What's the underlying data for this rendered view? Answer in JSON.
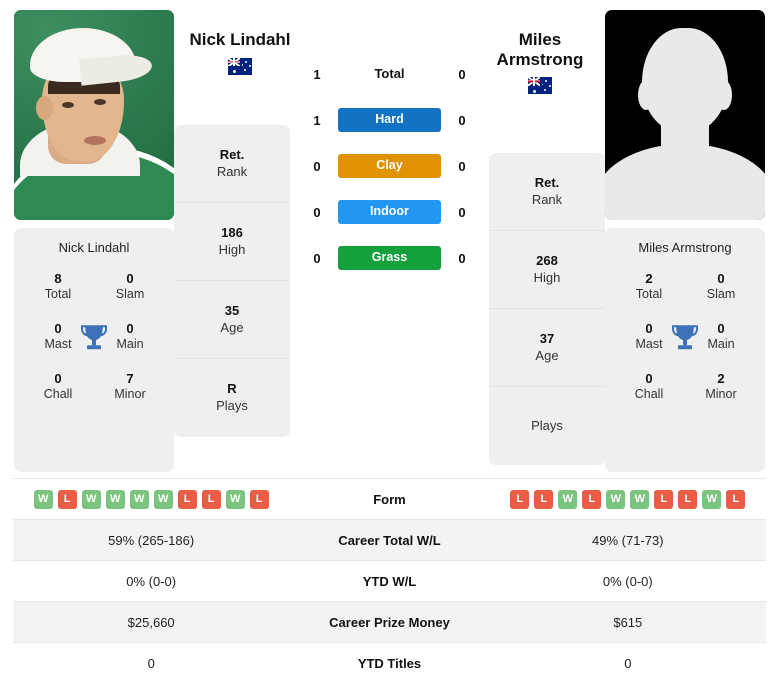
{
  "players": {
    "left": {
      "name": "Nick Lindahl",
      "country_flag": "australia-flag",
      "photo": "photo-nick-lindahl",
      "card_name": "Nick Lindahl",
      "titles": {
        "total_value": "8",
        "total_label": "Total",
        "slam_value": "0",
        "slam_label": "Slam",
        "mast_value": "0",
        "mast_label": "Mast",
        "main_value": "0",
        "main_label": "Main",
        "chall_value": "0",
        "chall_label": "Chall",
        "minor_value": "7",
        "minor_label": "Minor"
      },
      "info": [
        {
          "value": "Ret.",
          "label": "Rank"
        },
        {
          "value": "186",
          "label": "High"
        },
        {
          "value": "35",
          "label": "Age"
        },
        {
          "value": "R",
          "label": "Plays"
        }
      ],
      "surface_wins": {
        "total": "1",
        "hard": "1",
        "clay": "0",
        "indoor": "0",
        "grass": "0"
      },
      "form": [
        "W",
        "L",
        "W",
        "W",
        "W",
        "W",
        "L",
        "L",
        "W",
        "L"
      ],
      "career_total_wl": "59% (265-186)",
      "ytd_wl": "0% (0-0)",
      "career_prize_money": "$25,660",
      "ytd_titles": "0"
    },
    "right": {
      "name_line1": "Miles",
      "name_line2": "Armstrong",
      "name": "Miles Armstrong",
      "country_flag": "australia-flag",
      "photo": "placeholder-avatar",
      "card_name": "Miles Armstrong",
      "titles": {
        "total_value": "2",
        "total_label": "Total",
        "slam_value": "0",
        "slam_label": "Slam",
        "mast_value": "0",
        "mast_label": "Mast",
        "main_value": "0",
        "main_label": "Main",
        "chall_value": "0",
        "chall_label": "Chall",
        "minor_value": "2",
        "minor_label": "Minor"
      },
      "info": [
        {
          "value": "Ret.",
          "label": "Rank"
        },
        {
          "value": "268",
          "label": "High"
        },
        {
          "value": "37",
          "label": "Age"
        },
        {
          "value": "",
          "label": "Plays"
        }
      ],
      "surface_wins": {
        "total": "0",
        "hard": "0",
        "clay": "0",
        "indoor": "0",
        "grass": "0"
      },
      "form": [
        "L",
        "L",
        "W",
        "L",
        "W",
        "W",
        "L",
        "L",
        "W",
        "L"
      ],
      "career_total_wl": "49% (71-73)",
      "ytd_wl": "0% (0-0)",
      "career_prize_money": "$615",
      "ytd_titles": "0"
    }
  },
  "surfaces": [
    {
      "key": "total",
      "label": "Total",
      "color": "transparent",
      "plain": true
    },
    {
      "key": "hard",
      "label": "Hard",
      "color": "#1273c4",
      "plain": false
    },
    {
      "key": "clay",
      "label": "Clay",
      "color": "#e09200",
      "plain": false
    },
    {
      "key": "indoor",
      "label": "Indoor",
      "color": "#2196f3",
      "plain": false
    },
    {
      "key": "grass",
      "label": "Grass",
      "color": "#14a03c",
      "plain": false
    }
  ],
  "table_rows": [
    {
      "label": "Form",
      "type": "form"
    },
    {
      "label": "Career Total W/L",
      "type": "text",
      "key": "career_total_wl"
    },
    {
      "label": "YTD W/L",
      "type": "text",
      "key": "ytd_wl"
    },
    {
      "label": "Career Prize Money",
      "type": "text",
      "key": "career_prize_money"
    },
    {
      "label": "YTD Titles",
      "type": "text",
      "key": "ytd_titles"
    }
  ],
  "colors": {
    "hard": "#1273c4",
    "clay": "#e09200",
    "indoor": "#2196f3",
    "grass": "#14a03c",
    "win_badge": "#7ac47f",
    "loss_badge": "#eb5c44",
    "card_bg": "#efefef",
    "row_stripe": "#f3f3f3",
    "trophy": "#3d72b8"
  }
}
